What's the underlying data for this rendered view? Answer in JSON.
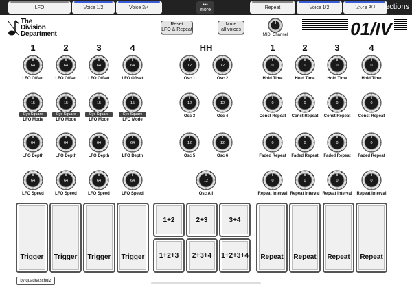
{
  "tabs_left": [
    {
      "label": "LFO"
    },
    {
      "label": "Voice 1/2"
    },
    {
      "label": "Voice 3/4"
    }
  ],
  "more_label": "more",
  "tabs_right": [
    {
      "label": "Repeat"
    },
    {
      "label": "Voice 1/2"
    },
    {
      "label": "Voice 3/4"
    }
  ],
  "no_connections": "No Connections",
  "logo": {
    "line1": "The",
    "line2": "Division",
    "line3": "Department"
  },
  "reset_button": {
    "line1": "Reset",
    "line2": "LFO & Repeat"
  },
  "mute_button": {
    "line1": "Mute",
    "line2": "all voices"
  },
  "midi_channel_label": "MIDI Channel",
  "brand": "01/IV",
  "lfo": {
    "columns": [
      "1",
      "2",
      "3",
      "4"
    ],
    "offset": {
      "label": "LFO Offset",
      "values": [
        "64",
        "64",
        "64",
        "64"
      ]
    },
    "mode": {
      "label": "LFO Mode",
      "values": [
        "15",
        "15",
        "15",
        "15"
      ],
      "type": "Cyc Square"
    },
    "depth": {
      "label": "LFO Depth",
      "values": [
        "64",
        "64",
        "64",
        "64"
      ]
    },
    "speed": {
      "label": "LFO Speed",
      "values": [
        "64",
        "64",
        "64",
        "64"
      ]
    }
  },
  "hh": {
    "title": "HH",
    "knobs": [
      {
        "label": "Osc 1",
        "value": "12"
      },
      {
        "label": "Osc 2",
        "value": "12"
      },
      {
        "label": "Osc 3",
        "value": "12"
      },
      {
        "label": "Osc 4",
        "value": "12"
      },
      {
        "label": "Osc 5",
        "value": "12"
      },
      {
        "label": "Osc 6",
        "value": "12"
      }
    ],
    "all": {
      "label": "Osc All",
      "value": "12"
    }
  },
  "repeat": {
    "columns": [
      "1",
      "2",
      "3",
      "4"
    ],
    "hold": {
      "label": "Hold Time",
      "values": [
        "0",
        "0",
        "0",
        "0"
      ]
    },
    "const": {
      "label": "Const Repeat",
      "values": [
        "0",
        "0",
        "0",
        "0"
      ]
    },
    "faded": {
      "label": "Faded Repeat",
      "values": [
        "0",
        "0",
        "0",
        "0"
      ]
    },
    "interval": {
      "label": "Repeat Interval",
      "values": [
        "0",
        "0",
        "0",
        "0"
      ]
    }
  },
  "trigger_pads": [
    "Trigger",
    "Trigger",
    "Trigger",
    "Trigger"
  ],
  "combo_pads": [
    "1+2",
    "2+3",
    "3+4",
    "1+2+3",
    "2+3+4",
    "1+2+3+4"
  ],
  "repeat_pads": [
    "Repeat",
    "Repeat",
    "Repeat",
    "Repeat"
  ],
  "credit": "by quadratschulz"
}
